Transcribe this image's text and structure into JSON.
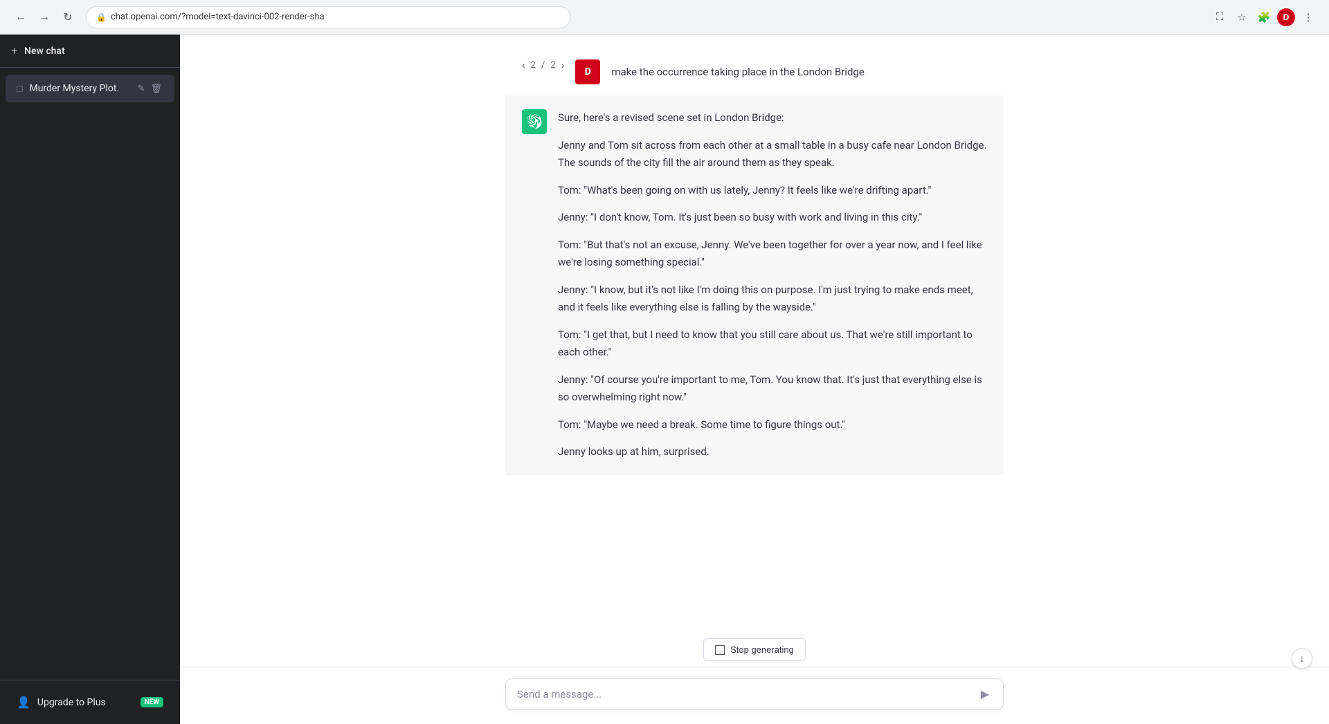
{
  "browser": {
    "url": "chat.openai.com/?model=text-davinci-002-render-sha",
    "back_btn": "◀",
    "forward_btn": "▶",
    "reload_btn": "↻"
  },
  "sidebar": {
    "new_chat_label": "New chat",
    "new_chat_icon": "+",
    "items": [
      {
        "label": "Murder Mystery Plot.",
        "active": true
      }
    ],
    "footer": {
      "upgrade_label": "Upgrade to Plus",
      "new_badge": "NEW"
    }
  },
  "chat": {
    "user_avatar_initial": "D",
    "navigation": {
      "current": "2",
      "separator": "/",
      "total": "2",
      "prev_arrow": "‹",
      "next_arrow": "›"
    },
    "user_message": "make the occurrence taking place in the London Bridge",
    "assistant_response": {
      "intro": "Sure, here's a revised scene set in London Bridge:",
      "paragraphs": [
        "Jenny and Tom sit across from each other at a small table in a busy cafe near London Bridge. The sounds of the city fill the air around them as they speak.",
        "Tom: \"What's been going on with us lately, Jenny? It feels like we're drifting apart.\"",
        "Jenny: \"I don't know, Tom. It's just been so busy with work and living in this city.\"",
        "Tom: \"But that's not an excuse, Jenny. We've been together for over a year now, and I feel like we're losing something special.\"",
        "Jenny: \"I know, but it's not like I'm doing this on purpose. I'm just trying to make ends meet, and it feels like everything else is falling by the wayside.\"",
        "Tom: \"I get that, but I need to know that you still care about us. That we're still important to each other.\"",
        "Jenny: \"Of course you're important to me, Tom. You know that. It's just that everything else is so overwhelming right now.\"",
        "Tom: \"Maybe we need a break. Some time to figure things out.\"",
        "Jenny looks up at him, surprised."
      ]
    },
    "stop_generating_label": "Stop generating",
    "input_placeholder": "Send a message...",
    "send_icon": "▶"
  },
  "colors": {
    "sidebar_bg": "#202123",
    "user_avatar_bg": "#d0021b",
    "assistant_avatar_bg": "#19c37d",
    "new_badge_bg": "#19c37d"
  }
}
